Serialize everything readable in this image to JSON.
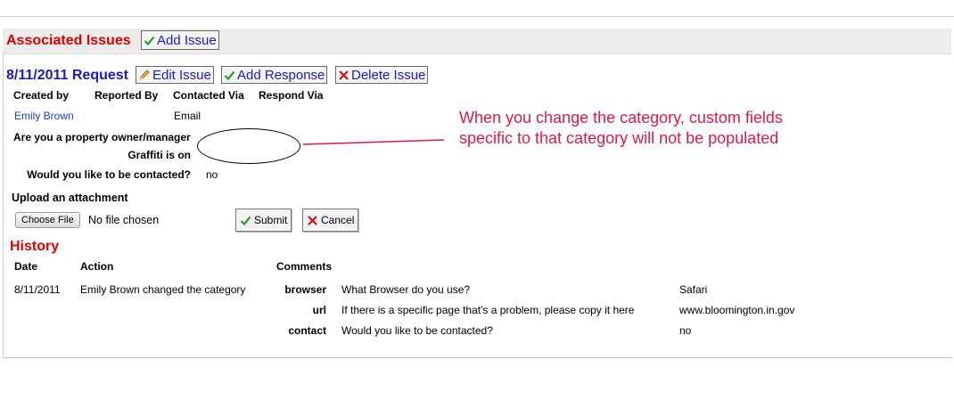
{
  "associated": {
    "title": "Associated Issues",
    "add_label": "Add Issue"
  },
  "request": {
    "title": "8/11/2011 Request",
    "edit_label": "Edit Issue",
    "response_label": "Add Response",
    "delete_label": "Delete Issue"
  },
  "details": {
    "headers": {
      "created_by": "Created by",
      "reported_by": "Reported By",
      "contacted_via": "Contacted Via",
      "respond_via": "Respond Via"
    },
    "created_by": "Emily Brown",
    "contacted_via": "Email",
    "fields": [
      {
        "label": "Are you a property owner/manager",
        "value": ""
      },
      {
        "label": "Graffiti is on",
        "value": ""
      },
      {
        "label": "Would you like to be contacted?",
        "value": "no"
      }
    ]
  },
  "annotation": {
    "line1": "When you change the category, custom fields",
    "line2": "specific to that category will not be populated",
    "color": "#e0194a"
  },
  "upload": {
    "label": "Upload an attachment",
    "choose_label": "Choose File",
    "file_status": "No file chosen",
    "submit_label": "Submit",
    "cancel_label": "Cancel"
  },
  "history": {
    "title": "History",
    "headers": {
      "date": "Date",
      "action": "Action",
      "comments": "Comments"
    },
    "date": "8/11/2011",
    "action": "Emily Brown changed the category",
    "rows": [
      {
        "field": "browser",
        "question": "What Browser do you use?",
        "answer": "Safari"
      },
      {
        "field": "url",
        "question": "If there is a specific page that's a problem, please copy it here",
        "answer": "www.bloomington.in.gov"
      },
      {
        "field": "contact",
        "question": "Would you like to be contacted?",
        "answer": "no"
      }
    ]
  },
  "colors": {
    "heading_red": "#e00000",
    "link_blue": "#1a1acc",
    "check_green": "#2a9a2a",
    "delete_red": "#e00000"
  }
}
